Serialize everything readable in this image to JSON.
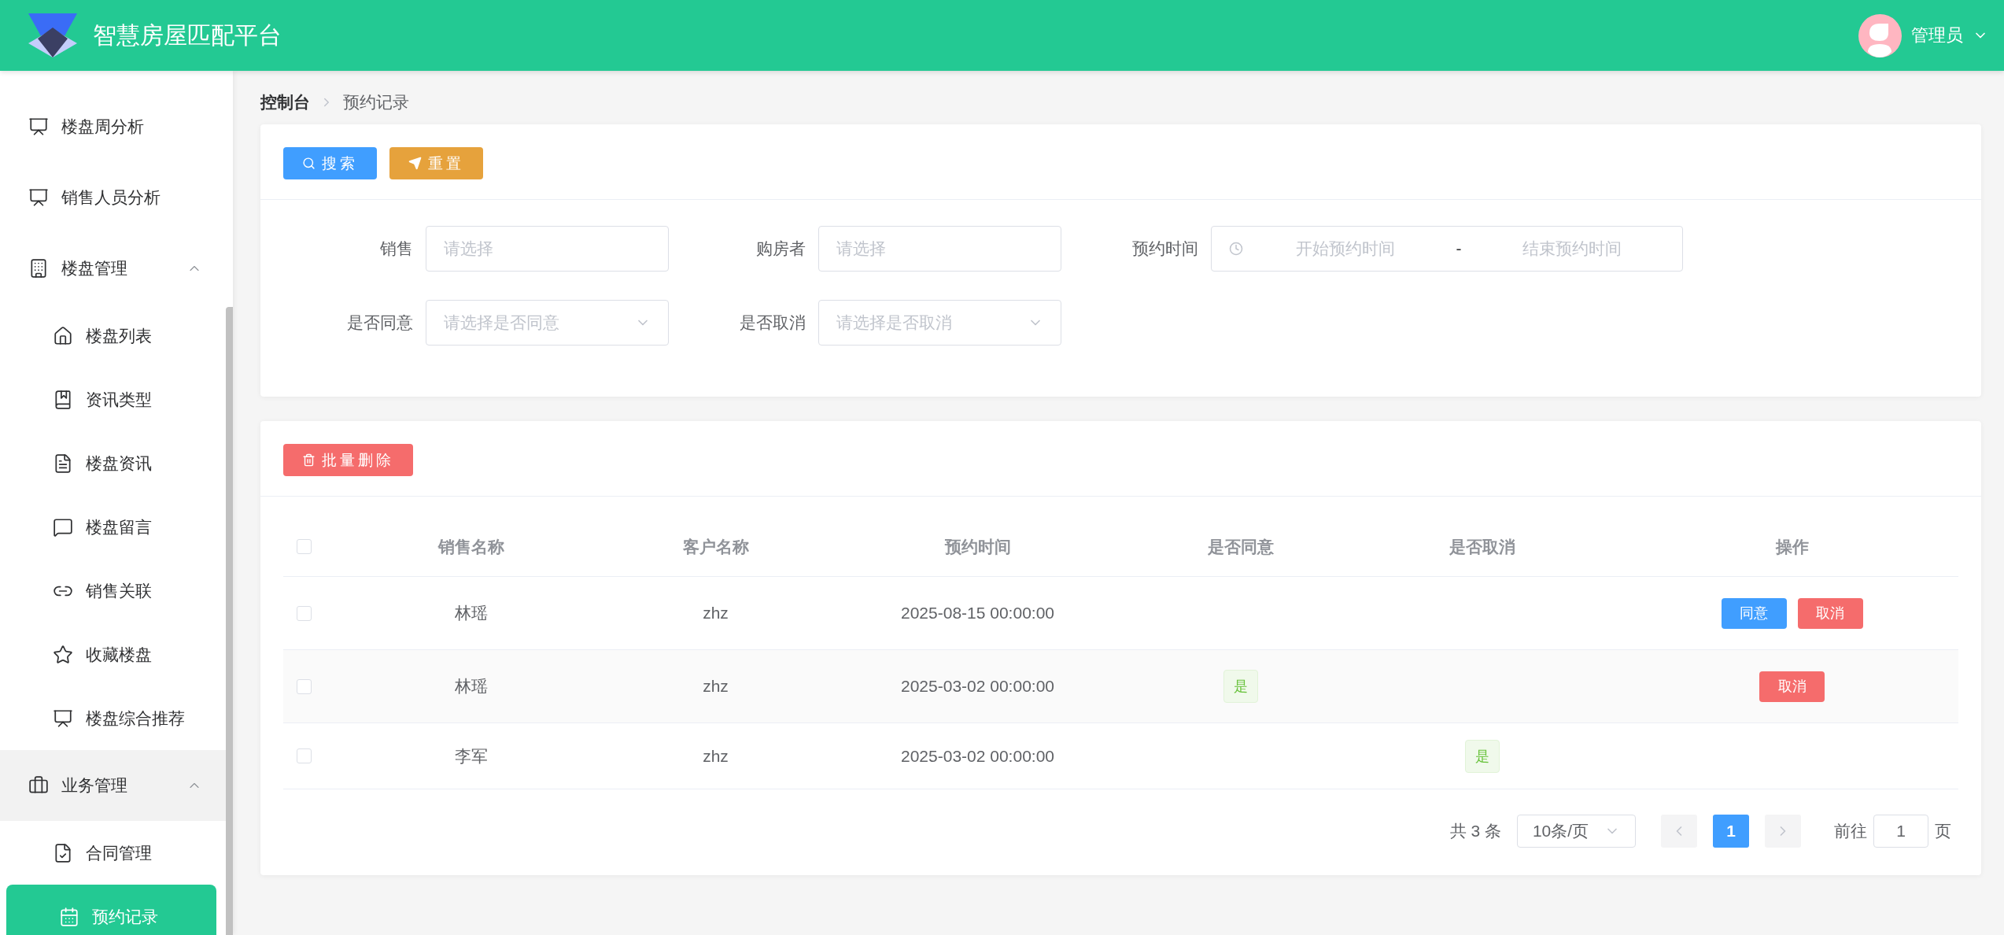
{
  "header": {
    "title": "智慧房屋匹配平台",
    "user": "管理员"
  },
  "sidebar": {
    "items": [
      {
        "label": "楼盘周分析",
        "selected": false
      },
      {
        "label": "销售人员分析",
        "selected": false
      },
      {
        "label": "楼盘管理",
        "selected": false,
        "expanded": true,
        "hovered": false,
        "children": [
          {
            "label": "楼盘列表",
            "selected": false
          },
          {
            "label": "资讯类型",
            "selected": false
          },
          {
            "label": "楼盘资讯",
            "selected": false
          },
          {
            "label": "楼盘留言",
            "selected": false
          },
          {
            "label": "销售关联",
            "selected": false
          },
          {
            "label": "收藏楼盘",
            "selected": false
          },
          {
            "label": "楼盘综合推荐",
            "selected": false
          }
        ]
      },
      {
        "label": "业务管理",
        "selected": false,
        "expanded": true,
        "hovered": true,
        "children": [
          {
            "label": "合同管理",
            "selected": false
          },
          {
            "label": "预约记录",
            "selected": true
          }
        ]
      }
    ]
  },
  "breadcrumb": [
    "控制台",
    "预约记录"
  ],
  "search_card": {
    "buttons": [
      {
        "label": "搜索",
        "kind": "search"
      },
      {
        "label": "重置",
        "kind": "reset"
      }
    ],
    "rows": [
      [
        {
          "label": "销售",
          "kind": "input",
          "placeholder": "请选择"
        },
        {
          "label": "购房者",
          "kind": "input",
          "placeholder": "请选择"
        },
        {
          "label": "预约时间",
          "kind": "daterange",
          "start_placeholder": "开始预约时间",
          "separator": "-",
          "end_placeholder": "结束预约时间"
        }
      ],
      [
        {
          "label": "是否同意",
          "kind": "select",
          "placeholder": "请选择是否同意"
        },
        {
          "label": "是否取消",
          "kind": "select",
          "placeholder": "请选择是否取消"
        }
      ]
    ]
  },
  "table_card": {
    "delete_button": "批量删除",
    "header_checked": false,
    "columns": [
      "销售名称",
      "客户名称",
      "预约时间",
      "是否同意",
      "是否取消",
      "操作"
    ],
    "rows": [
      {
        "checked": false,
        "sales": "林瑶",
        "customer": "zhz",
        "time": "2025-08-15 00:00:00",
        "actions": [
          {
            "label": "同意",
            "kind": "agree"
          },
          {
            "label": "取消",
            "kind": "cancel"
          }
        ]
      },
      {
        "checked": false,
        "sales": "林瑶",
        "customer": "zhz",
        "time": "2025-03-02 00:00:00",
        "agreed": "是",
        "actions": [
          {
            "label": "取消",
            "kind": "cancel"
          }
        ]
      },
      {
        "checked": false,
        "sales": "李军",
        "customer": "zhz",
        "time": "2025-03-02 00:00:00",
        "cancelled": "是",
        "actions": []
      }
    ]
  },
  "pagination": {
    "total": "共 3 条",
    "page_size": "10条/页",
    "prev_disabled": true,
    "pages": [
      {
        "label": "1",
        "selected": true
      }
    ],
    "next_disabled": true,
    "jump_label": "前往",
    "jump_value": "1",
    "page_unit": "页"
  }
}
